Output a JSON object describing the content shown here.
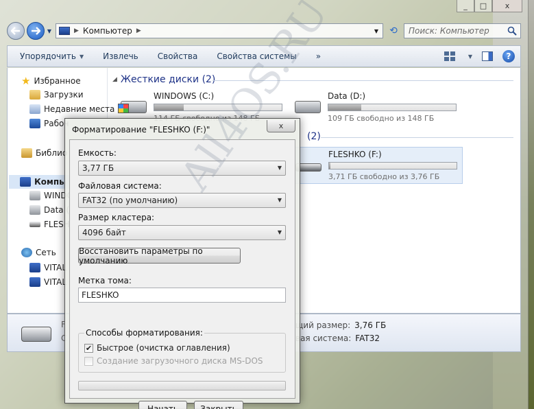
{
  "window": {
    "minimize": "_",
    "maximize": "□",
    "close": "x"
  },
  "nav": {
    "back_icon": "back-arrow-icon",
    "forward_icon": "forward-arrow-icon",
    "address": "Компьютер",
    "search_placeholder": "Поиск: Компьютер"
  },
  "toolbar": {
    "organize": "Упорядочить",
    "eject": "Извлечь",
    "properties": "Свойства",
    "system_properties": "Свойства системы",
    "more": "»"
  },
  "sidebar": {
    "favorites": "Избранное",
    "downloads": "Загрузки",
    "recent": "Недавние места",
    "desktop": "Рабоч",
    "libraries": "Библио",
    "computer": "Компь",
    "drive_c": "WINDO",
    "drive_d": "Data (",
    "drive_f": "FLESH",
    "network": "Сеть",
    "vital1": "VITAL",
    "vital2": "VITAL"
  },
  "main": {
    "hard_disks_header": "Жесткие диски (2)",
    "removable_header_count": "(2)",
    "drives": [
      {
        "name": "WINDOWS (C:)",
        "free_text": "114 ГБ свободно из 148 ГБ",
        "used_fraction": 0.23
      },
      {
        "name": "Data (D:)",
        "free_text": "109 ГБ свободно из 148 ГБ",
        "used_fraction": 0.26
      },
      {
        "name": "FLESHKO (F:)",
        "free_text": "3,71 ГБ свободно из 3,76 ГБ",
        "used_fraction": 0.01
      }
    ]
  },
  "details": {
    "name_partial": "F",
    "fs_partial": "С",
    "total_size_label": "щий размер:",
    "total_size_value": "3,76 ГБ",
    "filesystem_label": "вая система:",
    "filesystem_value": "FAT32"
  },
  "dialog": {
    "title": "Форматирование \"FLESHKO (F:)\"",
    "close": "x",
    "capacity_label": "Емкость:",
    "capacity_value": "3,77 ГБ",
    "fs_label": "Файловая система:",
    "fs_value": "FAT32 (по умолчанию)",
    "cluster_label": "Размер кластера:",
    "cluster_value": "4096 байт",
    "restore_button": "Восстановить параметры по умолчанию",
    "volume_label": "Метка тома:",
    "volume_value": "FLESHKO",
    "format_options_title": "Способы форматирования:",
    "quick_format": "Быстрое (очистка оглавления)",
    "quick_format_checked": true,
    "msdos_boot": "Создание загрузочного диска MS-DOS",
    "msdos_checked": false,
    "progress": 0,
    "start_button": "Начать",
    "close_button": "Закрыть"
  },
  "watermark": "All4OS.RU"
}
